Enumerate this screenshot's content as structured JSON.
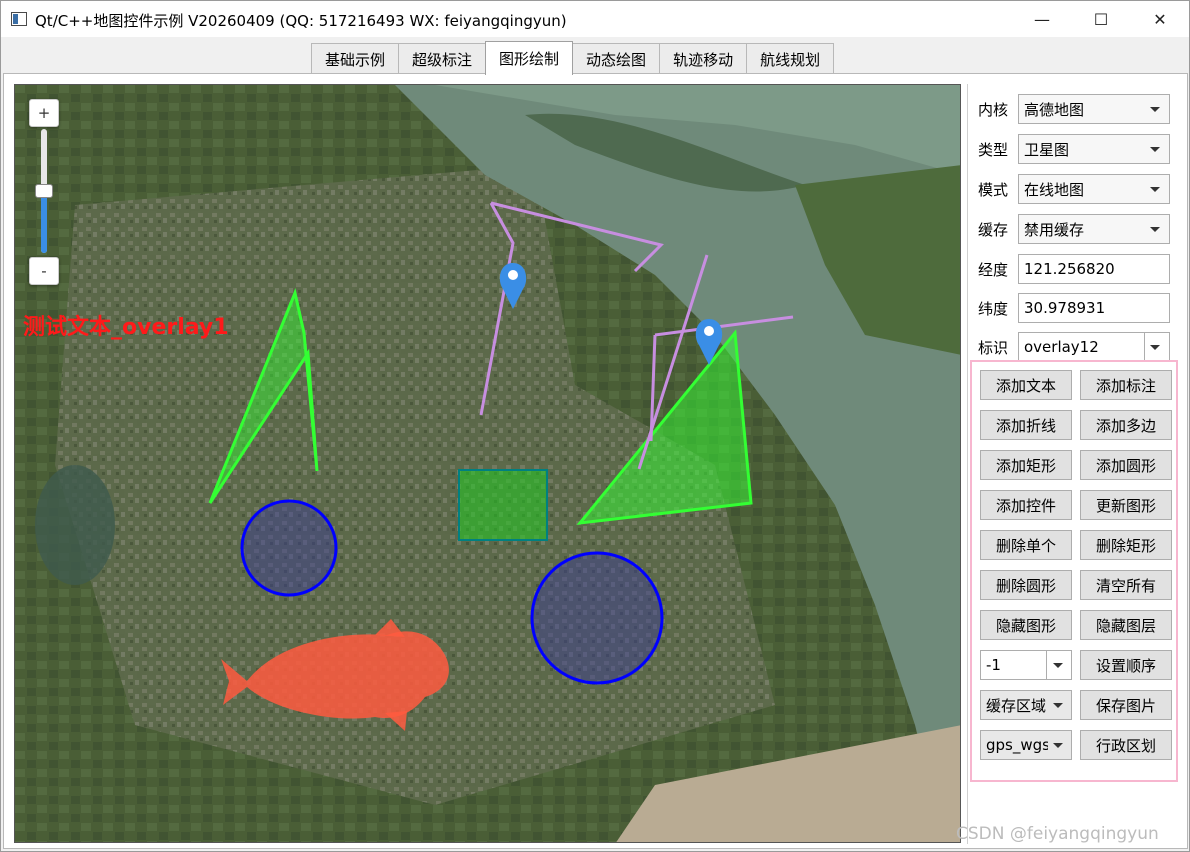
{
  "window": {
    "title": "Qt/C++地图控件示例 V20260409 (QQ: 517216493 WX: feiyangqingyun)",
    "minimize": "—",
    "maximize": "☐",
    "close": "✕"
  },
  "tabs": [
    {
      "label": "基础示例",
      "active": false
    },
    {
      "label": "超级标注",
      "active": false
    },
    {
      "label": "图形绘制",
      "active": true
    },
    {
      "label": "动态绘图",
      "active": false
    },
    {
      "label": "轨迹移动",
      "active": false
    },
    {
      "label": "航线规划",
      "active": false
    }
  ],
  "map": {
    "zoom_in": "+",
    "zoom_out": "-",
    "zoom_level_fraction": 0.5,
    "overlay_text": "测试文本_overlay1",
    "marker_icon": "map-pin-icon",
    "colors": {
      "polygon": "#33ff33",
      "rect_stroke": "#008080",
      "circle_stroke": "#0000ff",
      "polyline": "#c78ee0",
      "overlay_text": "#ff1a1a",
      "fish": "#ff5a40",
      "marker": "#3a8ee6"
    }
  },
  "side": {
    "core": {
      "label": "内核",
      "value": "高德地图"
    },
    "type": {
      "label": "类型",
      "value": "卫星图"
    },
    "mode": {
      "label": "模式",
      "value": "在线地图"
    },
    "cache": {
      "label": "缓存",
      "value": "禁用缓存"
    },
    "lng": {
      "label": "经度",
      "value": "121.256820"
    },
    "lat": {
      "label": "纬度",
      "value": "30.978931"
    },
    "mark": {
      "label": "标识",
      "value": "overlay12"
    }
  },
  "buttons": {
    "add_text": "添加文本",
    "add_marker": "添加标注",
    "add_polyline": "添加折线",
    "add_polygon": "添加多边",
    "add_rect": "添加矩形",
    "add_circle": "添加圆形",
    "add_control": "添加控件",
    "update_shape": "更新图形",
    "delete_one": "删除单个",
    "delete_rect": "删除矩形",
    "delete_circle": "删除圆形",
    "clear_all": "清空所有",
    "hide_shape": "隐藏图形",
    "hide_layer": "隐藏图层",
    "order_value": "-1",
    "set_order": "设置顺序",
    "cache_area": "缓存区域",
    "save_image": "保存图片",
    "coord_type": "gps_wgs",
    "admin_area": "行政区划"
  },
  "watermark": "CSDN @feiyangqingyun"
}
